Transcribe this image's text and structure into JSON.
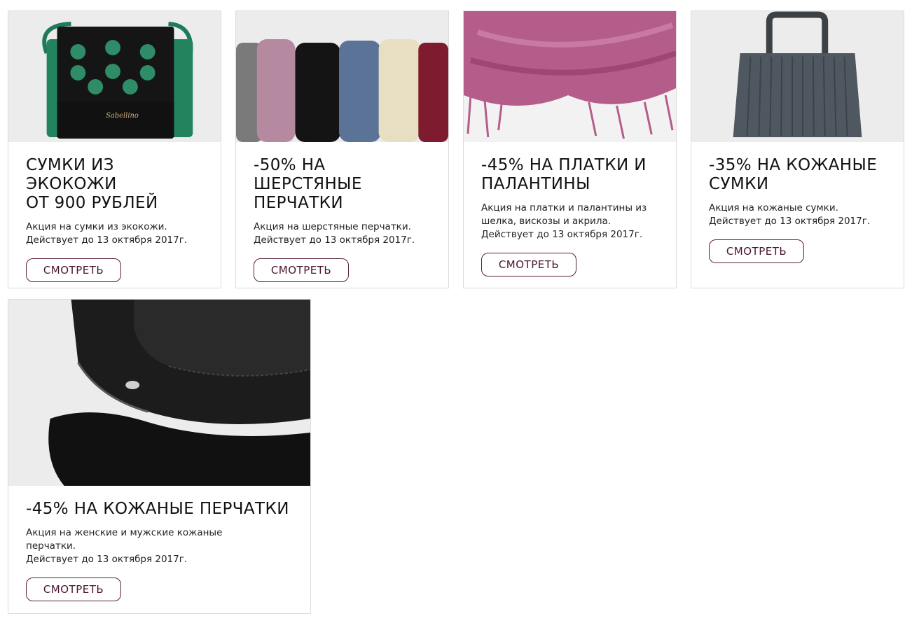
{
  "colors": {
    "button_border": "#5a1f3c",
    "button_text": "#4a1530",
    "card_border": "#dcdcdc",
    "image_bg": "#ececec"
  },
  "cards": [
    {
      "image": "green-black-eco-leather-bag-icon",
      "title_lines": [
        "СУМКИ ИЗ ЭКОКОЖИ",
        "ОТ 900 РУБЛЕЙ"
      ],
      "desc_lines": [
        "Акция на сумки из экокожи.",
        "Действует до 13 октября 2017г."
      ],
      "button": "СМОТРЕТЬ"
    },
    {
      "image": "wool-gloves-row-icon",
      "title_lines": [
        "-50% НА ШЕРСТЯНЫЕ",
        "ПЕРЧАТКИ"
      ],
      "desc_lines": [
        "Акция на шерстяные перчатки.",
        "Действует до 13 октября 2017г."
      ],
      "button": "СМОТРЕТЬ"
    },
    {
      "image": "pink-scarf-icon",
      "title_lines": [
        "-45% НА ПЛАТКИ И",
        "ПАЛАНТИНЫ"
      ],
      "desc_lines": [
        "Акция на платки и палантины из",
        "шелка, вискозы и акрила.",
        "Действует до 13 октября 2017г."
      ],
      "button": "СМОТРЕТЬ"
    },
    {
      "image": "grey-leather-handbag-icon",
      "title_lines": [
        "-35% НА КОЖАНЫЕ",
        "СУМКИ"
      ],
      "desc_lines": [
        "Акция на кожаные сумки.",
        "Действует до 13 октября 2017г."
      ],
      "button": "СМОТРЕТЬ"
    },
    {
      "image": "black-leather-gloves-icon",
      "title_lines": [
        "-45% НА КОЖАНЫЕ ПЕРЧАТКИ"
      ],
      "desc_lines": [
        "Акция на женские и мужские кожаные",
        "перчатки.",
        "Действует до 13 октября 2017г."
      ],
      "button": "СМОТРЕТЬ"
    }
  ]
}
